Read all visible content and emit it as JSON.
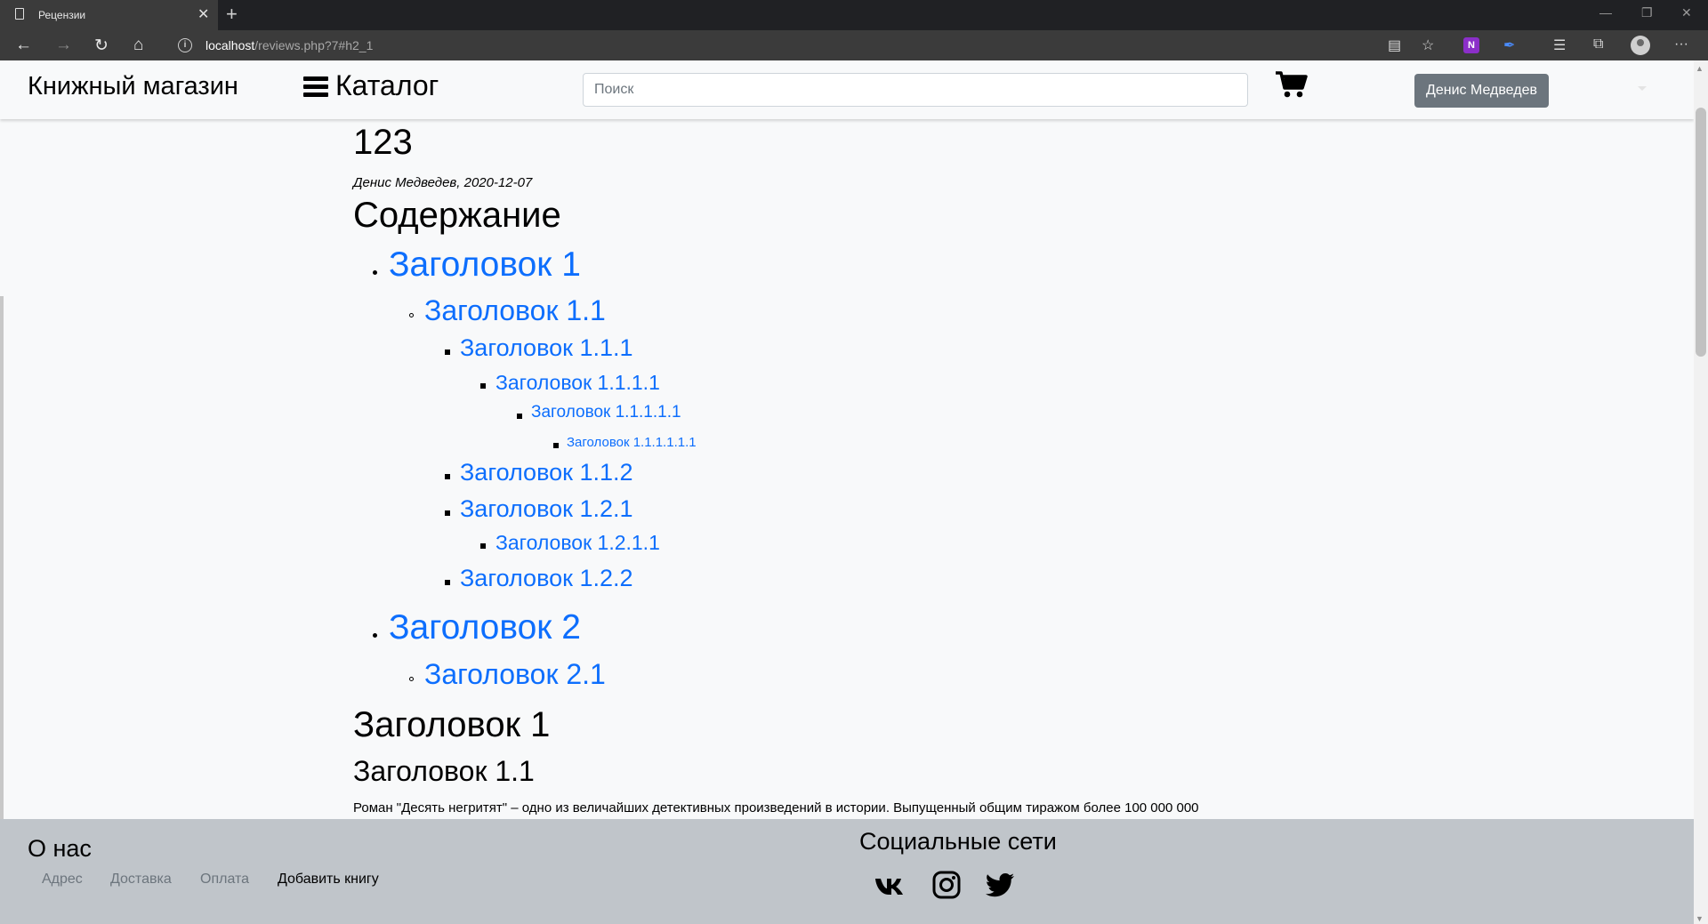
{
  "browser": {
    "tab_title": "Рецензии",
    "tab_close": "✕",
    "new_tab": "+",
    "url_host": "localhost",
    "url_path": "/reviews.php?7#h2_1",
    "more_menu": "···"
  },
  "navbar": {
    "brand": "Книжный магазин",
    "catalog_label": "Каталог",
    "search_placeholder": "Поиск",
    "user_button": "Денис Медведев"
  },
  "article": {
    "title": "123",
    "meta": "Денис Медведев, 2020-12-07",
    "toc_heading": "Содержание",
    "toc": [
      {
        "label": "Заголовок 1"
      },
      {
        "label": "Заголовок 1.1"
      },
      {
        "label": "Заголовок 1.1.1"
      },
      {
        "label": "Заголовок 1.1.1.1"
      },
      {
        "label": "Заголовок 1.1.1.1.1"
      },
      {
        "label": "Заголовок 1.1.1.1.1.1"
      },
      {
        "label": "Заголовок 1.1.2"
      },
      {
        "label": "Заголовок 1.2.1"
      },
      {
        "label": "Заголовок 1.2.1.1"
      },
      {
        "label": "Заголовок 1.2.2"
      },
      {
        "label": "Заголовок 2"
      },
      {
        "label": "Заголовок 2.1"
      }
    ],
    "section_heading": "Заголовок 1",
    "subsection_heading": "Заголовок 1.1",
    "paragraph": "Роман \"Десять негритят\" – одно из величайших детективных произведений в истории. Выпущенный общим тиражом более 100 000 000"
  },
  "footer": {
    "about_heading": "О нас",
    "links": [
      "Адрес",
      "Доставка",
      "Оплата",
      "Добавить книгу"
    ],
    "social_heading": "Социальные сети",
    "social_icons": [
      "vk-icon",
      "instagram-icon",
      "twitter-icon"
    ]
  },
  "colors": {
    "link": "#0d6efd",
    "user_button": "#6c757d",
    "footer_bg": "#c0c5ca",
    "page_bg": "#f8f9fa"
  }
}
